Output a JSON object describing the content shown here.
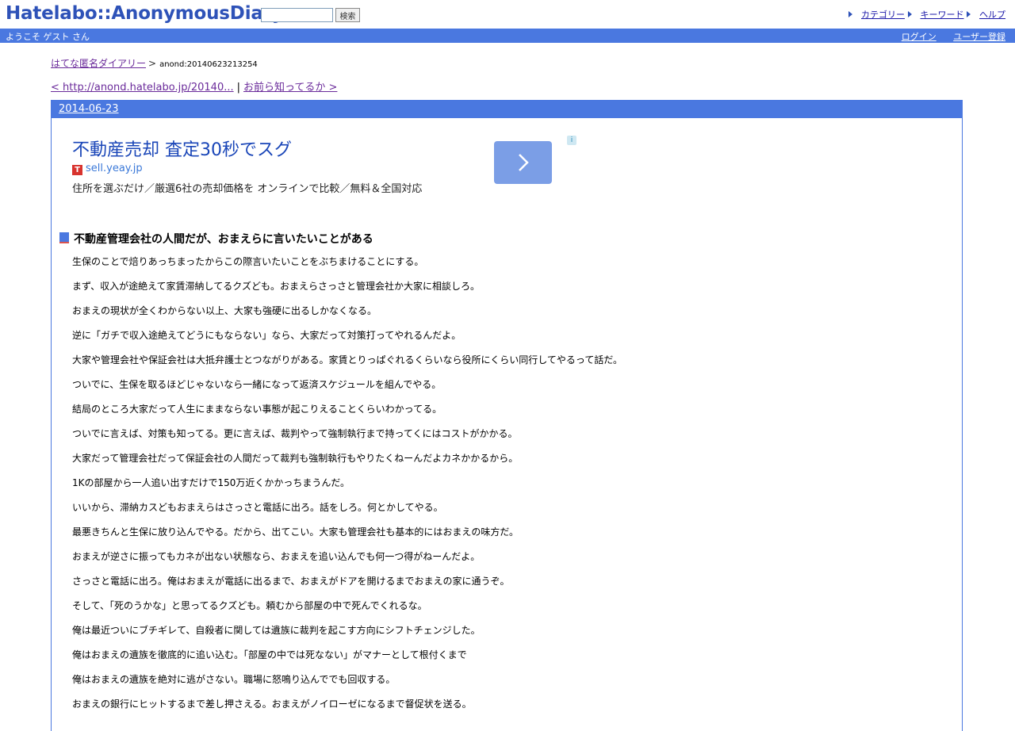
{
  "header": {
    "logo": "Hatelabo::AnonymousDiary",
    "search_placeholder": "",
    "search_button": "検索",
    "links": [
      "カテゴリー",
      "キーワード",
      "ヘルプ"
    ]
  },
  "userbar": {
    "welcome": "ようこそ ゲスト さん",
    "login": "ログイン",
    "register": "ユーザー登録"
  },
  "breadcrumb": {
    "root": "はてな匿名ダイアリー",
    "separator": ">",
    "current": "anond:20140623213254"
  },
  "nav": {
    "prev": "< http://anond.hatelabo.jp/20140...",
    "divider": "|",
    "next": "お前ら知ってるか >"
  },
  "day": {
    "date": "2014-06-23"
  },
  "ad": {
    "title": "不動産売却 査定30秒でスグ",
    "url": "sell.yeay.jp",
    "description": "住所を選ぶだけ／厳選6社の売却価格を オンラインで比較／無料＆全国対応",
    "logo_letter": "T"
  },
  "article": {
    "title": "不動産管理会社の人間だが、おまえらに言いたいことがある",
    "lines": [
      "生保のことで焙りあっちまったからこの際言いたいことをぶちまけることにする。",
      "まず、収入が途絶えて家賃滞納してるクズども。おまえらさっさと管理会社か大家に相談しろ。",
      "おまえの現状が全くわからない以上、大家も強硬に出るしかなくなる。",
      "逆に「ガチで収入途絶えてどうにもならない」なら、大家だって対策打ってやれるんだよ。",
      "大家や管理会社や保証会社は大抵弁護士とつながりがある。家賃とりっぱぐれるくらいなら役所にくらい同行してやるって話だ。",
      "ついでに、生保を取るほどじゃないなら一緒になって返済スケジュールを組んでやる。",
      "結局のところ大家だって人生にままならない事態が起こりえることくらいわかってる。",
      "ついでに言えば、対策も知ってる。更に言えば、裁判やって強制執行まで持ってくにはコストがかかる。",
      "大家だって管理会社だって保証会社の人間だって裁判も強制執行もやりたくねーんだよカネかかるから。",
      "1Kの部屋から一人追い出すだけで150万近くかかっちまうんだ。",
      "いいから、滞納カスどもおまえらはさっさと電話に出ろ。話をしろ。何とかしてやる。",
      "最悪きちんと生保に放り込んでやる。だから、出てこい。大家も管理会社も基本的にはおまえの味方だ。",
      "おまえが逆さに振ってもカネが出ない状態なら、おまえを追い込んでも何一つ得がねーんだよ。",
      "さっさと電話に出ろ。俺はおまえが電話に出るまで、おまえがドアを開けるまでおまえの家に通うぞ。",
      "そして、「死のうかな」と思ってるクズども。頼むから部屋の中で死んでくれるな。",
      "俺は最近ついにブチギレて、自殺者に関しては遺族に裁判を起こす方向にシフトチェンジした。",
      "俺はおまえの遺族を徹底的に追い込む。「部屋の中では死なない」がマナーとして根付くまで",
      "俺はおまえの遺族を絶対に逃がさない。職場に怒鳴り込んででも回収する。",
      "おまえの銀行にヒットするまで差し押さえる。おまえがノイローゼになるまで督促状を送る。"
    ]
  },
  "colors": {
    "accent": "#4a78e0",
    "logo": "#2e52b8",
    "link": "#1b18a8",
    "ad_title": "#1a46b8"
  }
}
